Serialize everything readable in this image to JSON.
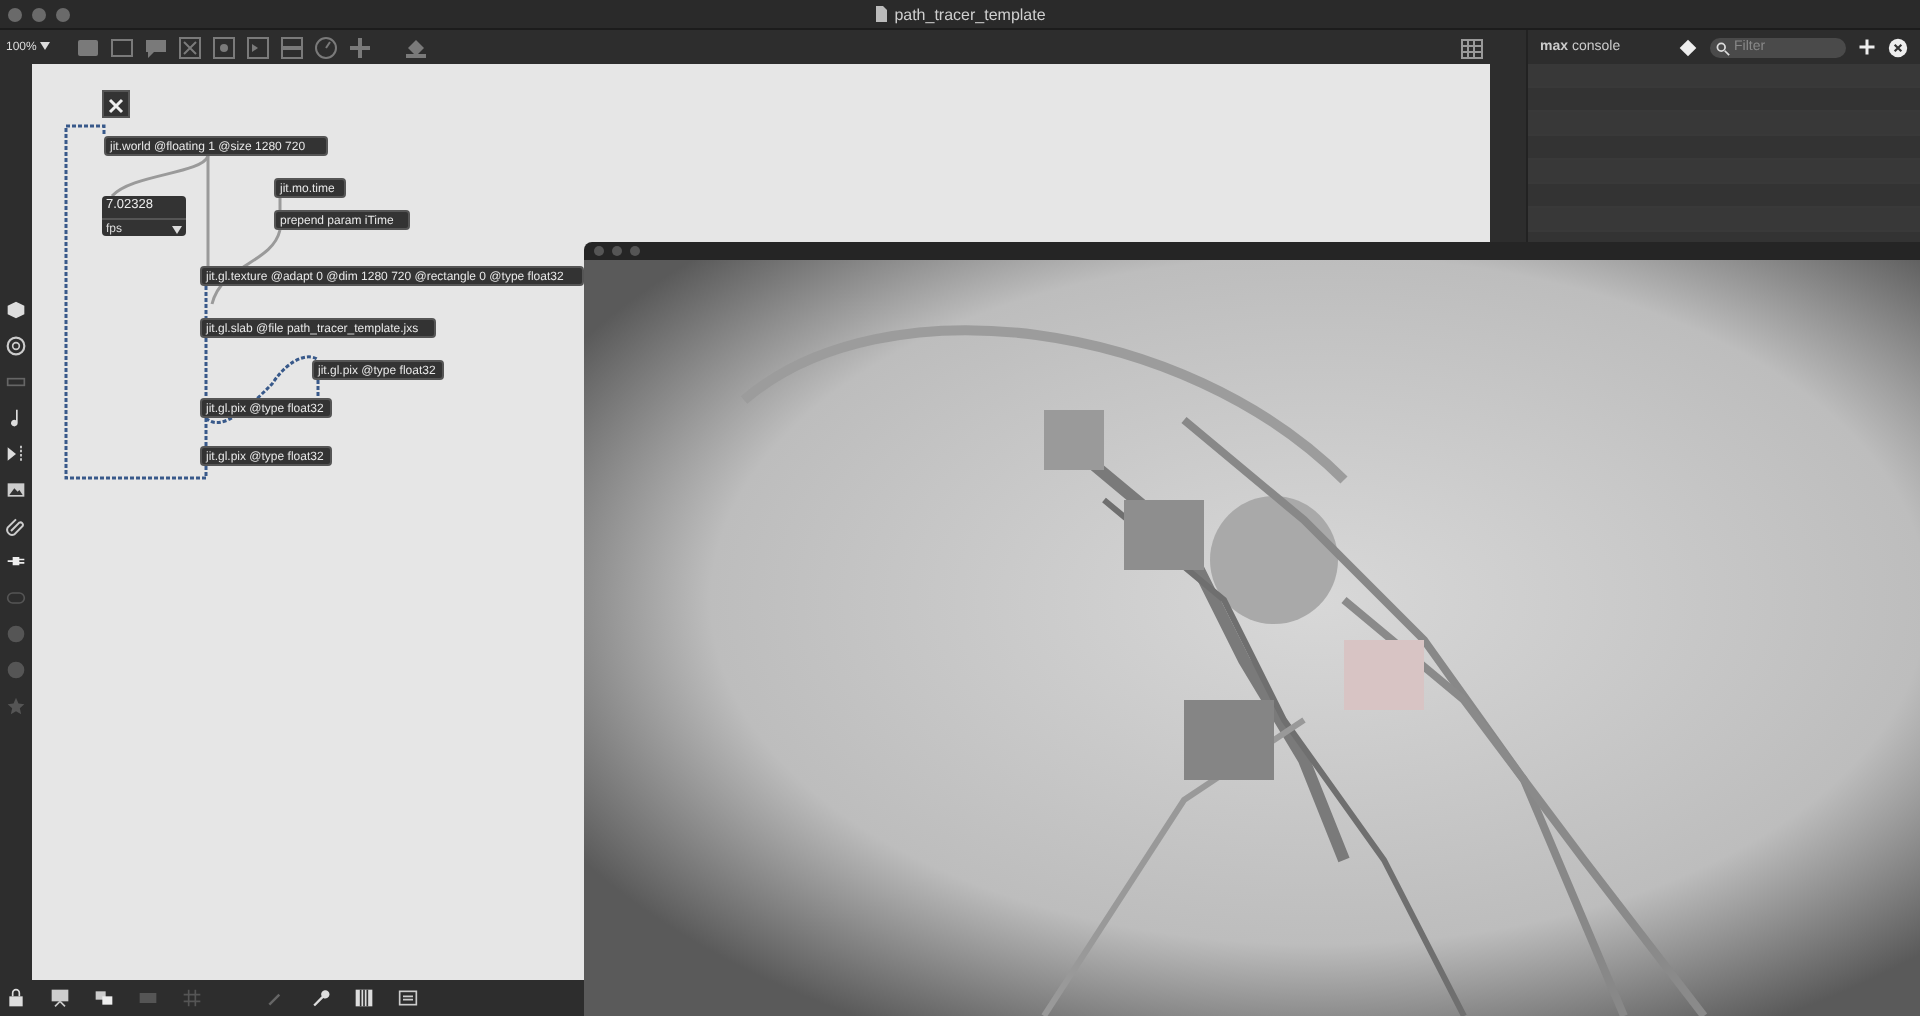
{
  "window": {
    "title": "path_tracer_template"
  },
  "toolbar": {
    "zoom": "100%"
  },
  "patch": {
    "toggle": {
      "checked": true
    },
    "objects": [
      {
        "kind": "object",
        "text": "jit.world @floating 1 @size 1280 720"
      },
      {
        "kind": "number",
        "value": "7.02328",
        "unit": "fps"
      },
      {
        "kind": "object",
        "text": "jit.mo.time"
      },
      {
        "kind": "object",
        "text": "prepend param iTime"
      },
      {
        "kind": "object",
        "text": "jit.gl.texture @adapt 0 @dim 1280 720 @rectangle 0 @type float32"
      },
      {
        "kind": "object",
        "text": "jit.gl.slab @file path_tracer_template.jxs"
      },
      {
        "kind": "object",
        "text": "jit.gl.pix @type float32"
      },
      {
        "kind": "object",
        "text": "jit.gl.pix @type float32"
      },
      {
        "kind": "object",
        "text": "jit.gl.pix @type float32"
      }
    ]
  },
  "console": {
    "title": "**max** console",
    "filter": {
      "placeholder": "Filter"
    }
  }
}
